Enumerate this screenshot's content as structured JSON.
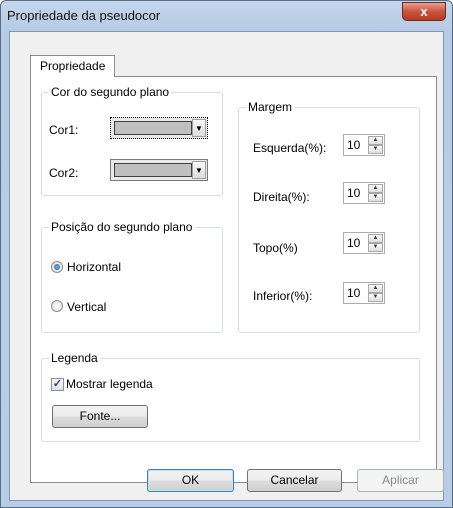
{
  "window": {
    "title": "Propriedade da pseudocor",
    "close_glyph": "x"
  },
  "tabs": [
    {
      "label": "Propriedade"
    }
  ],
  "background_color": {
    "legend": "Cor do segundo plano",
    "cor1_label": "Cor1:",
    "cor2_label": "Cor2:",
    "swatch_color": "#c0c0c0"
  },
  "background_position": {
    "legend": "Posição do segundo plano",
    "options": [
      {
        "label": "Horizontal",
        "checked": true
      },
      {
        "label": "Vertical",
        "checked": false
      }
    ]
  },
  "margin": {
    "legend": "Margem",
    "fields": [
      {
        "label": "Esquerda(%):",
        "value": "10"
      },
      {
        "label": "Direita(%):",
        "value": "10"
      },
      {
        "label": "Topo(%)",
        "value": "10"
      },
      {
        "label": "Inferior(%):",
        "value": "10"
      }
    ]
  },
  "legend_group": {
    "legend": "Legenda",
    "show_legend_label": "Mostrar legenda",
    "show_legend_checked": true,
    "font_button": "Fonte..."
  },
  "buttons": {
    "ok": "OK",
    "cancel": "Cancelar",
    "apply": "Aplicar"
  },
  "icons": {
    "dropdown": "chevron-down-icon",
    "spin_up": "chevron-up-icon",
    "spin_down": "chevron-down-icon",
    "checkmark": "check-icon",
    "close": "close-icon"
  }
}
